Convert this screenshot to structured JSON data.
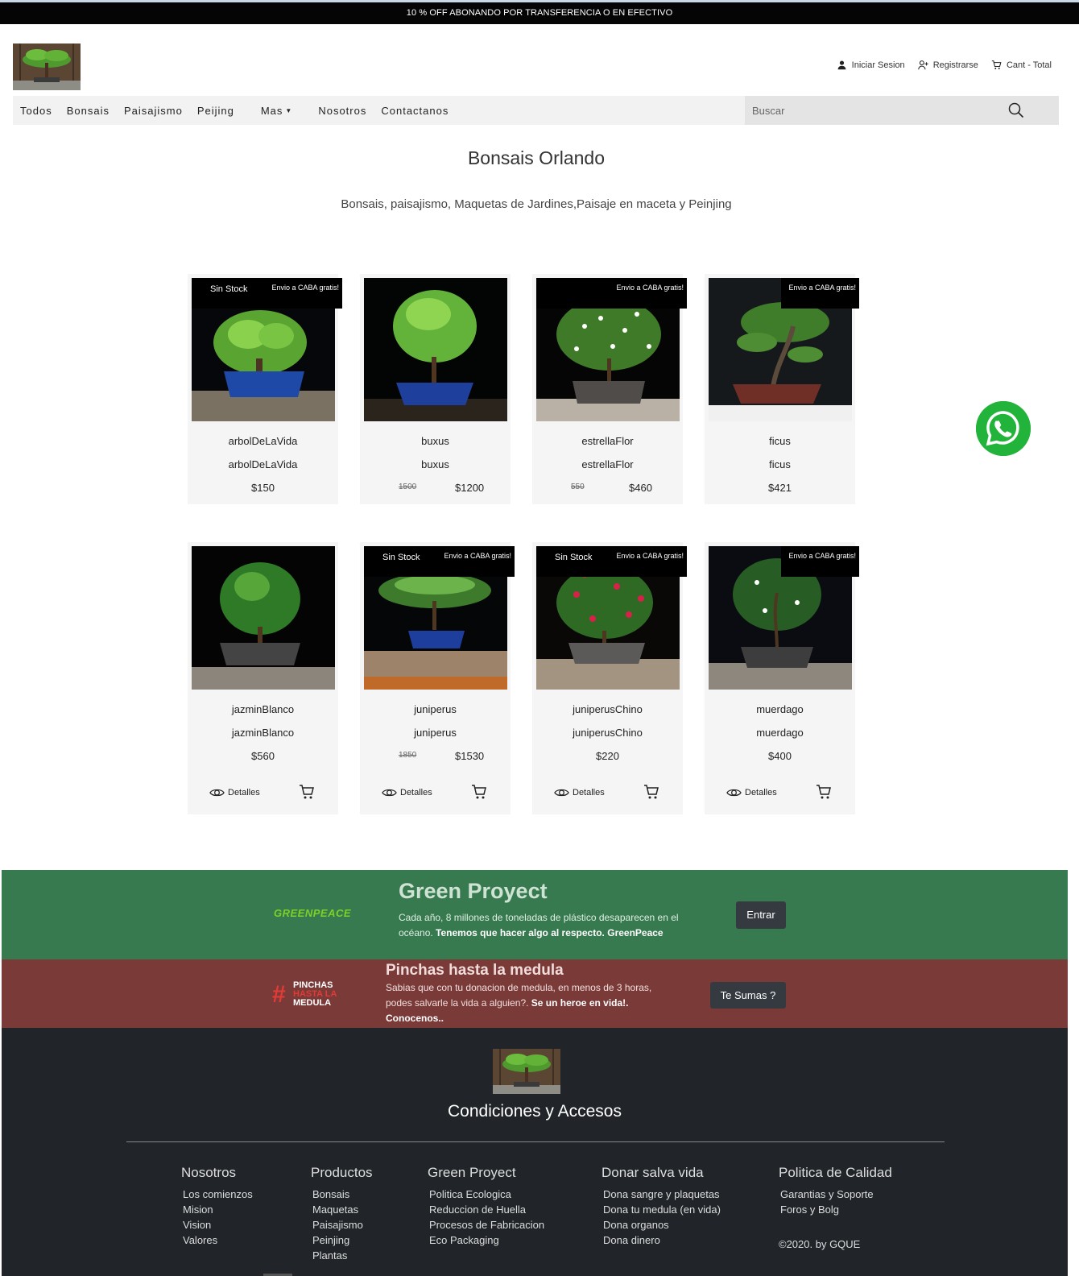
{
  "promo": "10 % OFF ABONANDO POR TRANSFERENCIA O EN EFECTIVO",
  "user_menu": {
    "login": "Iniciar Sesion",
    "register": "Registrarse",
    "cart": "Cant - Total"
  },
  "nav": {
    "items": [
      "Todos",
      "Bonsais",
      "Paisajismo",
      "Peijing",
      "Mas",
      "Nosotros",
      "Contactanos"
    ]
  },
  "search": {
    "placeholder": "Buscar"
  },
  "page": {
    "title": "Bonsais Orlando",
    "subtitle": "Bonsais, paisajismo, Maquetas de Jardines,Paisaje en maceta y Peinjing"
  },
  "badges": {
    "stock": "Sin Stock",
    "envio": "Envio a CABA gratis!"
  },
  "card_actions": {
    "details": "Detalles"
  },
  "products": [
    {
      "name": "arbolDeLaVida",
      "subtitle": "arbolDeLaVida",
      "price": "$150",
      "old_price": "",
      "stock": true,
      "envio": true
    },
    {
      "name": "buxus",
      "subtitle": "buxus",
      "price": "$1200",
      "old_price": "1500",
      "stock": false,
      "envio": false
    },
    {
      "name": "estrellaFlor",
      "subtitle": "estrellaFlor",
      "price": "$460",
      "old_price": "550",
      "stock": false,
      "envio": true
    },
    {
      "name": "ficus",
      "subtitle": "ficus",
      "price": "$421",
      "old_price": "",
      "stock": false,
      "envio": true
    },
    {
      "name": "jazminBlanco",
      "subtitle": "jazminBlanco",
      "price": "$560",
      "old_price": "",
      "stock": false,
      "envio": false
    },
    {
      "name": "juniperus",
      "subtitle": "juniperus",
      "price": "$1530",
      "old_price": "1850",
      "stock": true,
      "envio": true
    },
    {
      "name": "juniperusChino",
      "subtitle": "juniperusChino",
      "price": "$220",
      "old_price": "",
      "stock": true,
      "envio": true
    },
    {
      "name": "muerdago",
      "subtitle": "muerdago",
      "price": "$400",
      "old_price": "",
      "stock": false,
      "envio": true
    }
  ],
  "green_banner": {
    "logo": "GREENPEACE",
    "title": "Green Proyect",
    "text": "Cada año, 8 millones de toneladas de plástico desaparecen en el océano.",
    "text_bold": "Tenemos que hacer algo al respecto. GreenPeace",
    "button": "Entrar"
  },
  "red_banner": {
    "logo_hash": "#",
    "logo_lines": [
      "PINCHAS",
      "HASTA LA",
      "MEDULA"
    ],
    "title": "Pinchas hasta la medula",
    "text": "Sabias que con tu donacion de medula, en menos de 3 horas, podes salvarle la vida a alguien?.",
    "text_bold": "Se un heroe en vida!. Conocenos..",
    "button": "Te Sumas ?"
  },
  "footer": {
    "title": "Condiciones y Accesos",
    "columns": [
      {
        "heading": "Nosotros",
        "links": [
          "Los comienzos",
          "Mision",
          "Vision",
          "Valores"
        ]
      },
      {
        "heading": "Productos",
        "links": [
          "Bonsais",
          "Maquetas",
          "Paisajismo",
          "Peinjing",
          "Plantas"
        ]
      },
      {
        "heading": "Green Proyect",
        "links": [
          "Politica Ecologica",
          "Reduccion de Huella",
          "Procesos de Fabricacion",
          "Eco Packaging"
        ]
      },
      {
        "heading": "Donar salva vida",
        "links": [
          "Dona sangre y plaquetas",
          "Dona tu medula (en vida)",
          "Dona organos",
          "Dona dinero"
        ]
      },
      {
        "heading": "Politica de Calidad",
        "links": [
          "Garantias y Soporte",
          "Foros y Bolg"
        ]
      }
    ],
    "copyright": "©2020. by GQUE"
  },
  "colors": {
    "promo_bg": "#050505",
    "green_banner": "#387a4f",
    "red_banner": "#7a3a38",
    "footer_bg": "#212529",
    "whatsapp": "#22b33a"
  },
  "icons": [
    "user-icon",
    "add-user-icon",
    "cart-icon",
    "search-icon",
    "eye-icon",
    "whatsapp-icon",
    "caret-down-icon"
  ]
}
